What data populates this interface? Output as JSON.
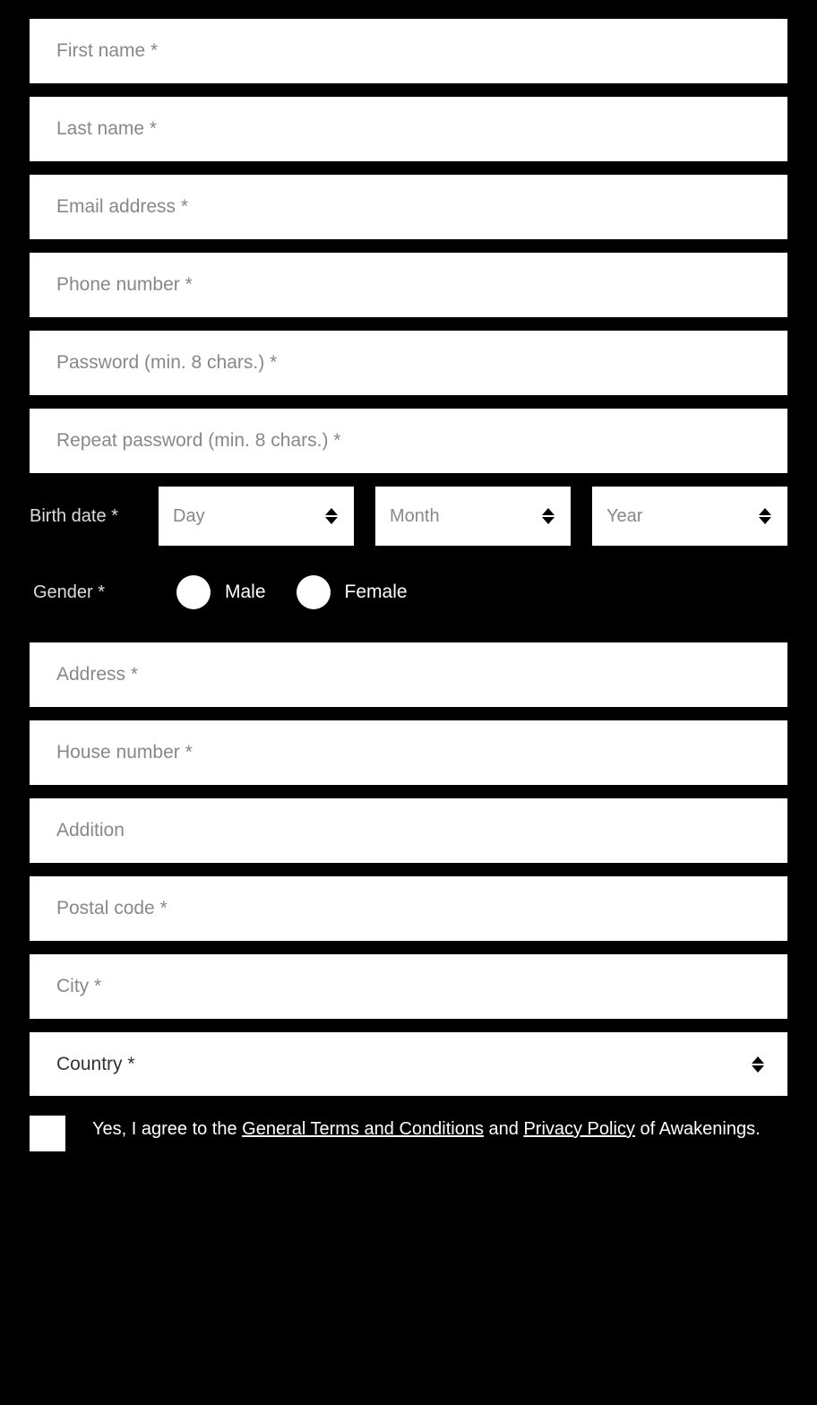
{
  "form": {
    "first_name_placeholder": "First name *",
    "last_name_placeholder": "Last name *",
    "email_placeholder": "Email address *",
    "phone_placeholder": "Phone number *",
    "password_placeholder": "Password (min. 8 chars.) *",
    "repeat_password_placeholder": "Repeat password (min. 8 chars.) *",
    "birth_label": "Birth date *",
    "day_label": "Day",
    "month_label": "Month",
    "year_label": "Year",
    "gender_label": "Gender *",
    "gender_male": "Male",
    "gender_female": "Female",
    "address_placeholder": "Address *",
    "house_number_placeholder": "House number *",
    "addition_placeholder": "Addition",
    "postal_code_placeholder": "Postal code *",
    "city_placeholder": "City *",
    "country_label": "Country *",
    "terms_prefix": "Yes, I agree to the ",
    "terms_link": "General Terms and Conditions",
    "terms_and": " and ",
    "privacy_link": "Privacy Policy",
    "terms_suffix": " of Awakenings."
  }
}
